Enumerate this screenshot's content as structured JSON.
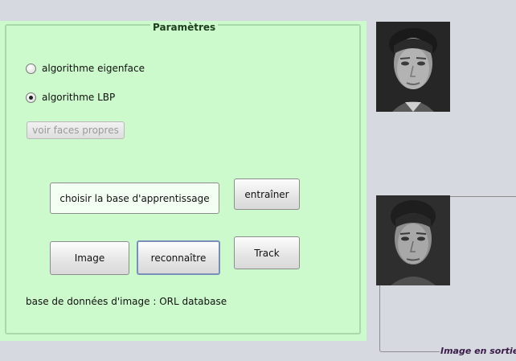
{
  "panel": {
    "title": "Paramètres",
    "radios": [
      {
        "label": "algorithme eigenface",
        "selected": false
      },
      {
        "label": "algorithme LBP",
        "selected": true
      }
    ],
    "buttons": {
      "eigenfaces": "voir faces propres",
      "choose_base": "choisir la base d'apprentissage",
      "train": "entraîner",
      "image": "Image",
      "recognize": "reconnaître",
      "track": "Track"
    },
    "database_label": "base de données  d'image : ORL database"
  },
  "output": {
    "label": "Image en sortie"
  }
}
